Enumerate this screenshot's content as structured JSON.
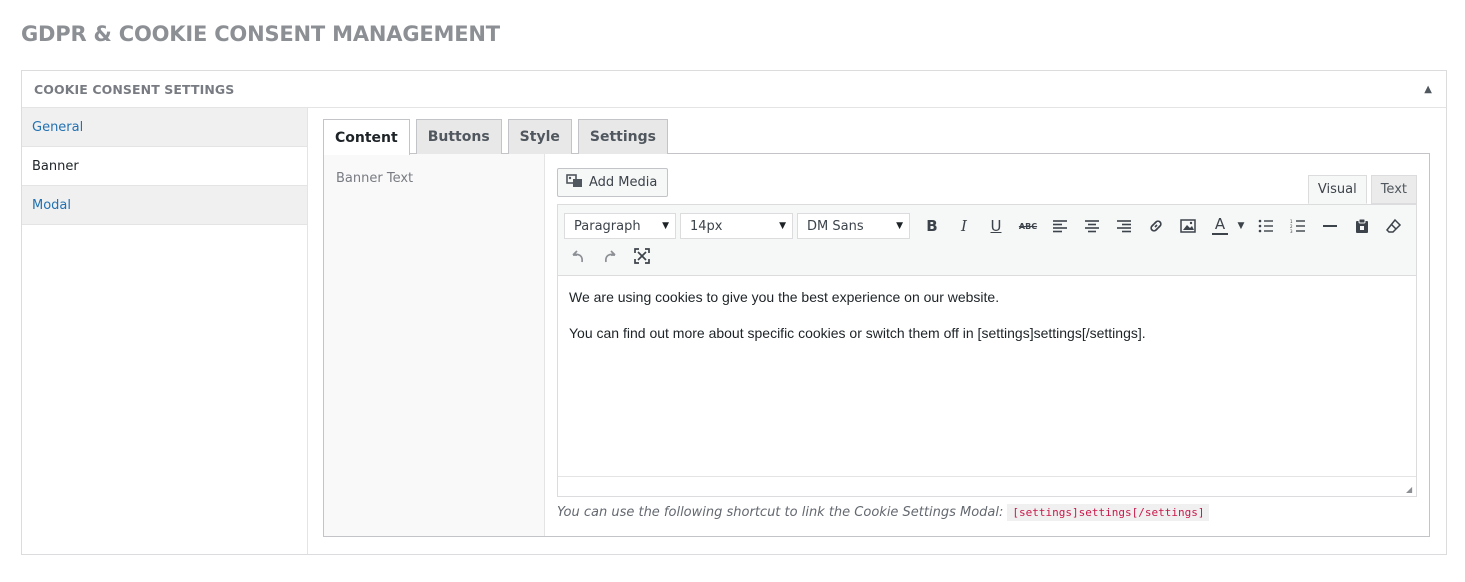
{
  "page": {
    "title": "GDPR & COOKIE CONSENT MANAGEMENT"
  },
  "panel": {
    "title": "COOKIE CONSENT SETTINGS",
    "toggle_icon": "triangle-up-icon"
  },
  "sidebar": {
    "items": [
      {
        "label": "General"
      },
      {
        "label": "Banner"
      },
      {
        "label": "Modal"
      }
    ]
  },
  "tabs": [
    {
      "label": "Content"
    },
    {
      "label": "Buttons"
    },
    {
      "label": "Style"
    },
    {
      "label": "Settings"
    }
  ],
  "field": {
    "label": "Banner Text"
  },
  "editor": {
    "add_media_label": "Add Media",
    "mode_visual": "Visual",
    "mode_text": "Text",
    "format_select": "Paragraph",
    "size_select": "14px",
    "font_select": "DM Sans",
    "paragraphs": [
      "We are using cookies to give you the best experience on our website.",
      "You can find out more about specific cookies or switch them off in [settings]settings[/settings]."
    ]
  },
  "hint": {
    "text": "You can use the following shortcut to link the Cookie Settings Modal:",
    "code": "[settings]settings[/settings]"
  },
  "colors": {
    "link": "#2271b1",
    "code": "#c9184a",
    "title": "#8c8f94"
  }
}
